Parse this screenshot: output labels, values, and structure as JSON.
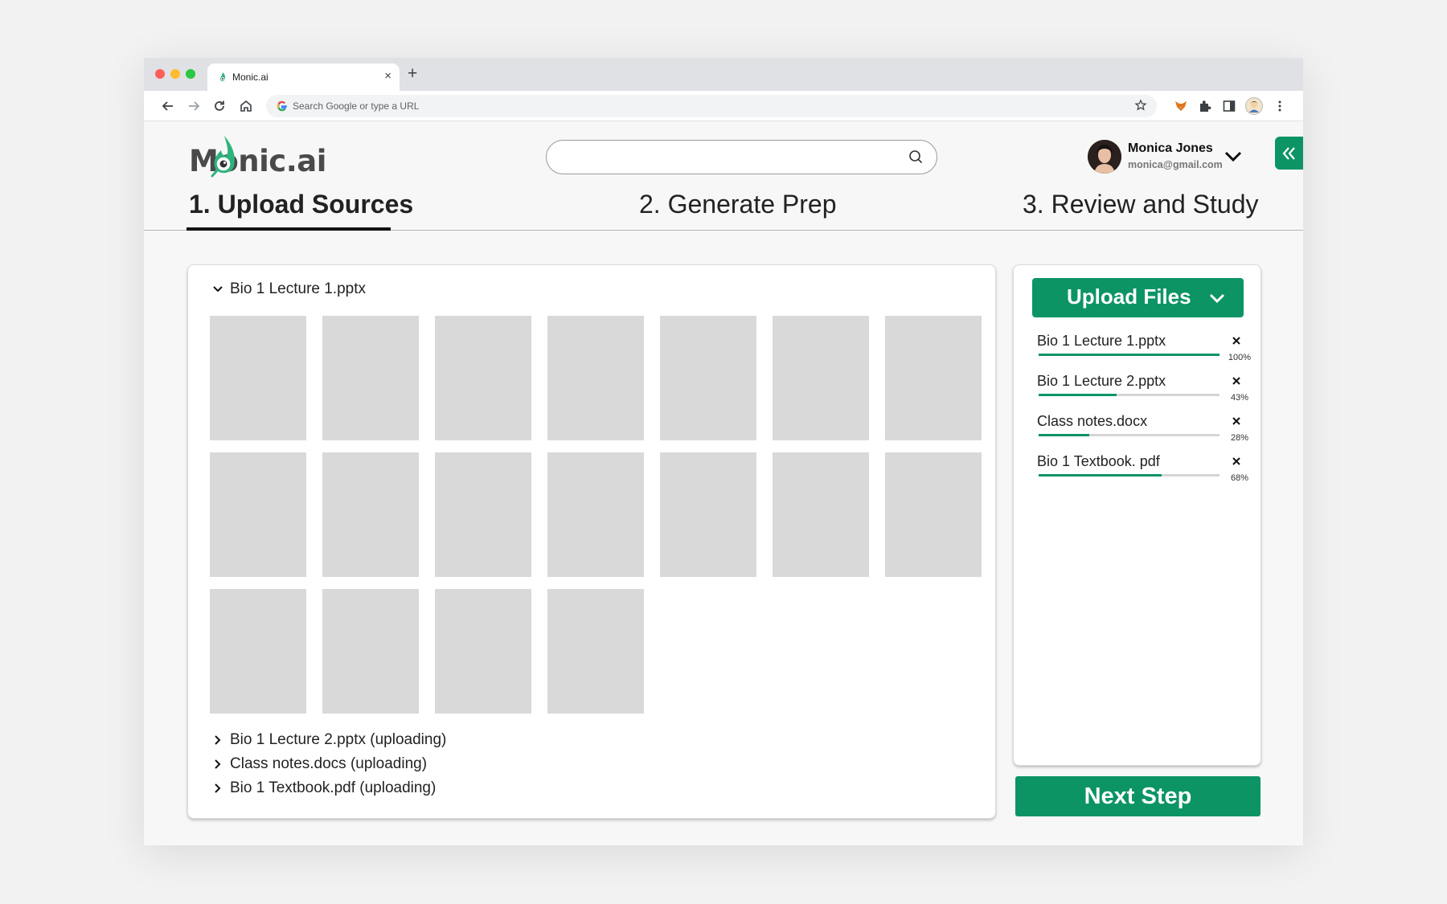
{
  "browser": {
    "tab_title": "Monic.ai",
    "new_tab_label": "+",
    "tab_close_label": "×",
    "omnibox_placeholder": "Search Google or type a URL"
  },
  "app": {
    "logo_text": "Monic.ai",
    "search": {
      "value": "",
      "placeholder": ""
    },
    "user": {
      "name": "Monica Jones",
      "email": "monica@gmail.com"
    }
  },
  "steps": [
    {
      "label": "1. Upload Sources",
      "active": true
    },
    {
      "label": "2. Generate Prep",
      "active": false
    },
    {
      "label": "3. Review and Study",
      "active": false
    }
  ],
  "sources": {
    "expanded_file": {
      "name": "Bio 1 Lecture 1.pptx",
      "slide_count": 18
    },
    "collapsed_files": [
      "Bio 1 Lecture 2.pptx (uploading)",
      "Class notes.docs (uploading)",
      "Bio 1 Textbook.pdf (uploading)"
    ]
  },
  "uploads": {
    "button_label": "Upload Files",
    "items": [
      {
        "name": "Bio 1 Lecture 1.pptx",
        "progress": 100,
        "percent_label": "100%"
      },
      {
        "name": "Bio 1 Lecture 2.pptx",
        "progress": 43,
        "percent_label": "43%"
      },
      {
        "name": "Class notes.docx",
        "progress": 28,
        "percent_label": "28%"
      },
      {
        "name": "Bio 1 Textbook. pdf",
        "progress": 68,
        "percent_label": "68%"
      }
    ]
  },
  "next_step_label": "Next Step",
  "colors": {
    "accent": "#0c9465",
    "slide_placeholder": "#d9d9d9"
  },
  "icons": {
    "back": "arrow-left-icon",
    "forward": "arrow-right-icon",
    "reload": "reload-icon",
    "home": "home-icon",
    "bookmark": "star-icon",
    "collapse": "double-chevron-left-icon",
    "search": "search-icon"
  }
}
